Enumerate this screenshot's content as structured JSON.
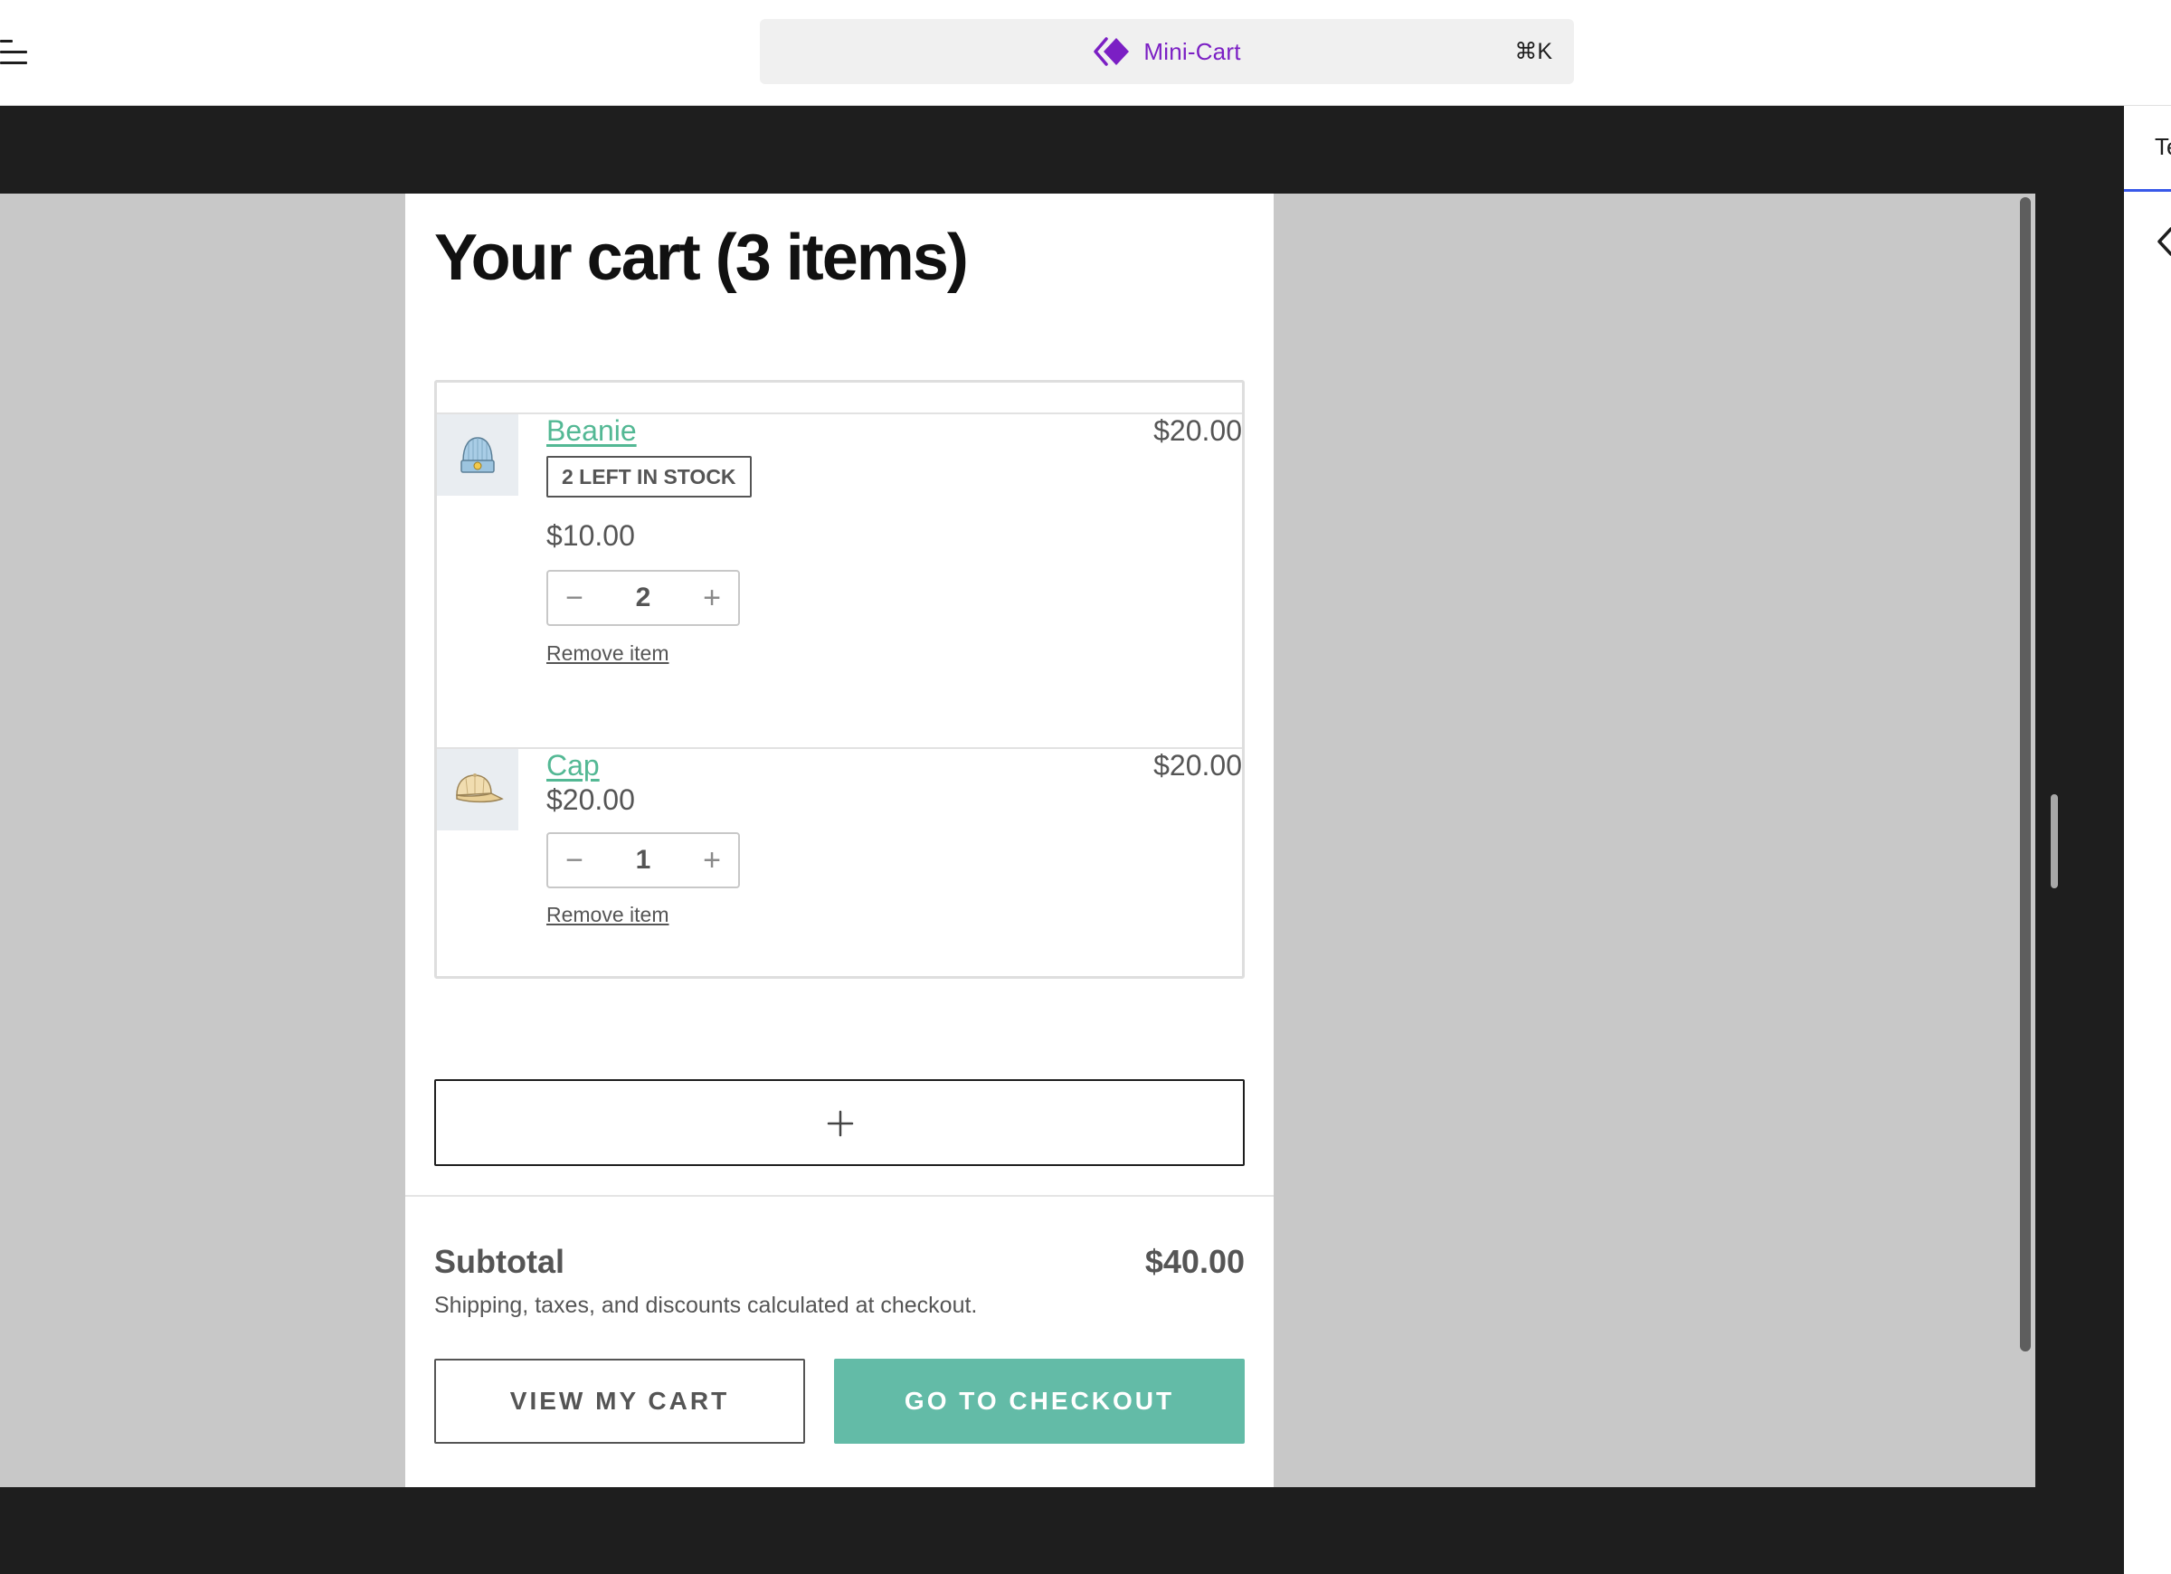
{
  "toolbar": {
    "command_title": "Mini-Cart",
    "shortcut": "⌘K"
  },
  "sidebar": {
    "tab_label": "Te"
  },
  "cart": {
    "title": "Your cart (3 items)",
    "items": [
      {
        "name": "Beanie",
        "stock_badge": "2 LEFT IN STOCK",
        "unit_price": "$10.00",
        "quantity": "2",
        "line_total": "$20.00",
        "remove_label": "Remove item",
        "thumbnail_icon": "beanie-icon"
      },
      {
        "name": "Cap",
        "unit_price": "$20.00",
        "quantity": "1",
        "line_total": "$20.00",
        "remove_label": "Remove item",
        "thumbnail_icon": "cap-icon"
      }
    ],
    "stepper": {
      "minus": "−",
      "plus": "+"
    },
    "add_block_icon": "plus-icon",
    "subtotal_label": "Subtotal",
    "subtotal_value": "$40.00",
    "shipping_note": "Shipping, taxes, and discounts calculated at checkout.",
    "view_cart_label": "VIEW MY CART",
    "checkout_label": "GO TO CHECKOUT"
  },
  "colors": {
    "accent": "#7b1fc4",
    "product_link": "#53b894",
    "checkout_button": "#63bba7",
    "editor_dark": "#1e1e1e",
    "canvas_gray": "#c8c8c8"
  }
}
